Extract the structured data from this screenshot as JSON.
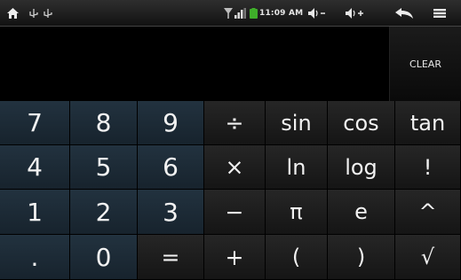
{
  "status_bar": {
    "time": "11:09 AM",
    "icons": [
      "home-icon",
      "usb-icon",
      "wifi-icon",
      "signal-icon",
      "battery-icon",
      "volume-down-icon",
      "volume-up-icon",
      "back-icon",
      "menu-icon"
    ]
  },
  "display": {
    "value": ""
  },
  "clear_label": "CLEAR",
  "keys": {
    "k7": "7",
    "k8": "8",
    "k9": "9",
    "div": "÷",
    "sin": "sin",
    "cos": "cos",
    "tan": "tan",
    "k4": "4",
    "k5": "5",
    "k6": "6",
    "mul": "×",
    "ln": "ln",
    "log": "log",
    "fact": "!",
    "k1": "1",
    "k2": "2",
    "k3": "3",
    "sub": "−",
    "pi": "π",
    "e": "e",
    "pow": "^",
    "dot": ".",
    "k0": "0",
    "eq": "=",
    "add": "+",
    "lpar": "(",
    "rpar": ")",
    "sqrt": "√"
  },
  "colors": {
    "number_key": "#1c2a36",
    "operator_key": "#1e1e1e",
    "background": "#000000"
  }
}
